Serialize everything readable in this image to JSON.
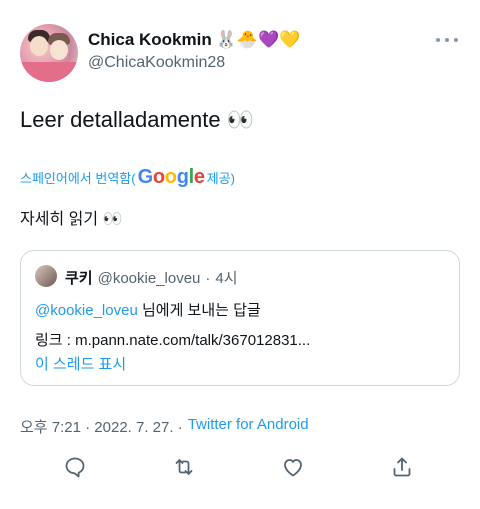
{
  "author": {
    "display_name": "Chica Kookmin",
    "name_emojis": "🐰🐣💜💛",
    "handle": "@ChicaKookmin28"
  },
  "tweet": {
    "text": "Leer detalladamente 👀"
  },
  "translation": {
    "prefix": "스페인어에서 번역함(",
    "google_parts": [
      "G",
      "o",
      "o",
      "g",
      "l",
      "e"
    ],
    "suffix": " 제공)",
    "translated_text": "자세히 읽기 👀"
  },
  "quote": {
    "name": "쿠키",
    "handle": "@kookie_loveu",
    "separator": " · ",
    "time": "4시",
    "reply_mention": "@kookie_loveu",
    "reply_suffix": " 님에게 보내는 답글",
    "link_text": "링크 : m.pann.nate.com/talk/367012831...",
    "show_thread": "이 스레드 표시"
  },
  "meta": {
    "time": "오후 7:21 · 2022. 7. 27. ·",
    "source": "Twitter for Android"
  },
  "actions": {
    "reply": "reply-icon",
    "retweet": "retweet-icon",
    "like": "like-icon",
    "share": "share-icon"
  },
  "colors": {
    "accent": "#1d9bf0",
    "secondary_text": "#536471",
    "border": "#cfd9de"
  }
}
